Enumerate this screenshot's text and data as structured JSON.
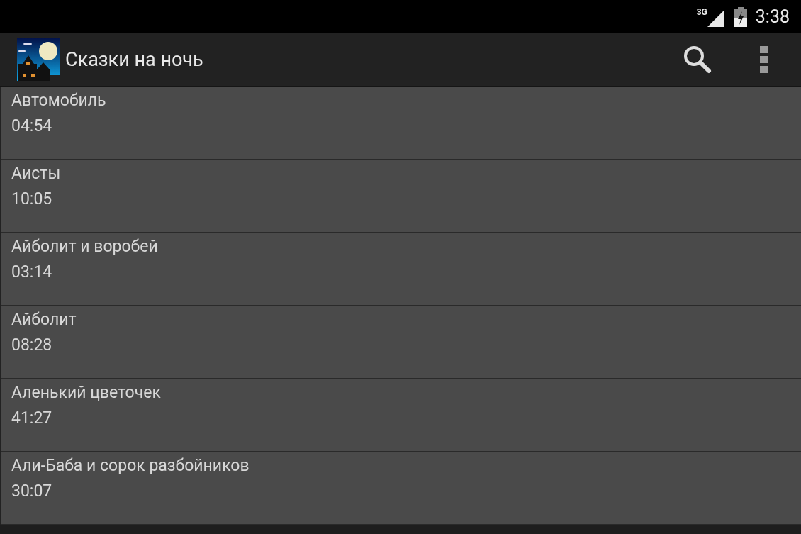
{
  "status_bar": {
    "network": "3G",
    "time": "3:38"
  },
  "action_bar": {
    "title": "Сказки на ночь"
  },
  "items": [
    {
      "title": "Автомобиль",
      "duration": "04:54"
    },
    {
      "title": "Аисты",
      "duration": "10:05"
    },
    {
      "title": "Айболит и воробей",
      "duration": "03:14"
    },
    {
      "title": "Айболит",
      "duration": "08:28"
    },
    {
      "title": "Аленький цветочек",
      "duration": "41:27"
    },
    {
      "title": "Али-Баба и сорок разбойников",
      "duration": "30:07"
    }
  ]
}
